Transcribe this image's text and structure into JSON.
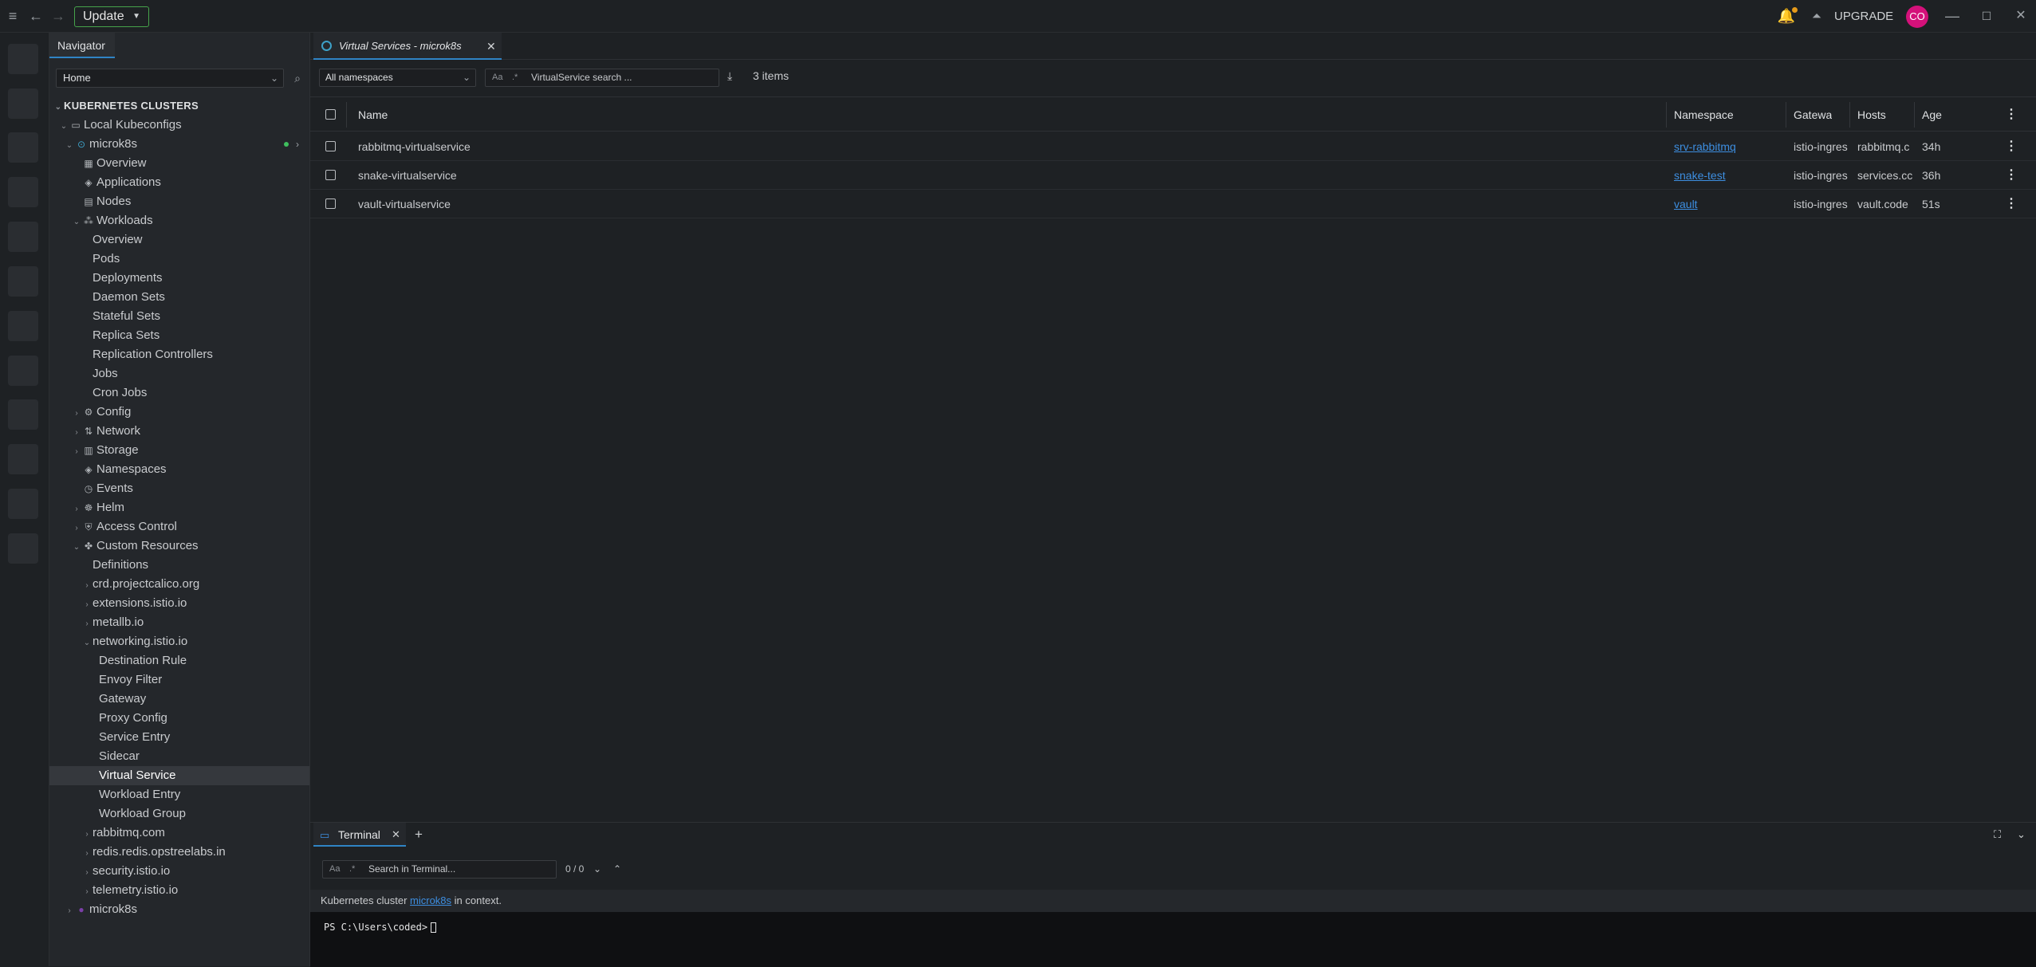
{
  "titlebar": {
    "update_label": "Update",
    "upgrade_label": "UPGRADE",
    "avatar_initials": "CO"
  },
  "sidebar": {
    "tab_label": "Navigator",
    "home_select": "Home",
    "section_title": "KUBERNETES CLUSTERS",
    "local_kubeconfigs": "Local Kubeconfigs",
    "cluster_name": "microk8s",
    "items": [
      {
        "label": "Overview"
      },
      {
        "label": "Applications"
      },
      {
        "label": "Nodes"
      },
      {
        "label": "Workloads"
      },
      {
        "label": "Overview"
      },
      {
        "label": "Pods"
      },
      {
        "label": "Deployments"
      },
      {
        "label": "Daemon Sets"
      },
      {
        "label": "Stateful Sets"
      },
      {
        "label": "Replica Sets"
      },
      {
        "label": "Replication Controllers"
      },
      {
        "label": "Jobs"
      },
      {
        "label": "Cron Jobs"
      },
      {
        "label": "Config"
      },
      {
        "label": "Network"
      },
      {
        "label": "Storage"
      },
      {
        "label": "Namespaces"
      },
      {
        "label": "Events"
      },
      {
        "label": "Helm"
      },
      {
        "label": "Access Control"
      },
      {
        "label": "Custom Resources"
      },
      {
        "label": "Definitions"
      },
      {
        "label": "crd.projectcalico.org"
      },
      {
        "label": "extensions.istio.io"
      },
      {
        "label": "metallb.io"
      },
      {
        "label": "networking.istio.io"
      },
      {
        "label": "Destination Rule"
      },
      {
        "label": "Envoy Filter"
      },
      {
        "label": "Gateway"
      },
      {
        "label": "Proxy Config"
      },
      {
        "label": "Service Entry"
      },
      {
        "label": "Sidecar"
      },
      {
        "label": "Virtual Service"
      },
      {
        "label": "Workload Entry"
      },
      {
        "label": "Workload Group"
      },
      {
        "label": "rabbitmq.com"
      },
      {
        "label": "redis.redis.opstreelabs.in"
      },
      {
        "label": "security.istio.io"
      },
      {
        "label": "telemetry.istio.io"
      },
      {
        "label": "microk8s"
      }
    ]
  },
  "main": {
    "tab_label": "Virtual Services - microk8s",
    "namespace_select": "All namespaces",
    "search_aa": "Aa",
    "search_regex": ".*",
    "search_placeholder": "VirtualService search ...",
    "items_count": "3 items",
    "columns": {
      "name": "Name",
      "namespace": "Namespace",
      "gateways": "Gatewa",
      "hosts": "Hosts",
      "age": "Age"
    },
    "rows": [
      {
        "name": "rabbitmq-virtualservice",
        "namespace": "srv-rabbitmq",
        "gateways": "istio-ingres",
        "hosts": "rabbitmq.c",
        "age": "34h"
      },
      {
        "name": "snake-virtualservice",
        "namespace": "snake-test",
        "gateways": "istio-ingres",
        "hosts": "services.cc",
        "age": "36h"
      },
      {
        "name": "vault-virtualservice",
        "namespace": "vault",
        "gateways": "istio-ingres",
        "hosts": "vault.code",
        "age": "51s"
      }
    ]
  },
  "dock": {
    "tab_label": "Terminal",
    "search_aa": "Aa",
    "search_regex": ".*",
    "search_placeholder": "Search in Terminal...",
    "match_count": "0 / 0",
    "context_prefix": "Kubernetes cluster",
    "context_cluster": "microk8s",
    "context_suffix": "in context.",
    "prompt": "PS C:\\Users\\coded>"
  },
  "colors": {
    "accent_blue": "#2f84c5",
    "update_green": "#46a34b",
    "avatar_pink": "#d4117a",
    "link_blue": "#3d8ee0"
  }
}
